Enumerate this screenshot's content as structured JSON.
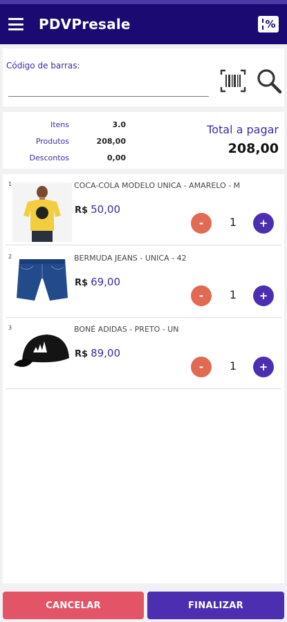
{
  "app": {
    "title": "PDVPresale"
  },
  "barcode": {
    "label": "Código de barras:",
    "value": "",
    "placeholder": ""
  },
  "summary": {
    "items_label": "Itens",
    "items_value": "3.0",
    "products_label": "Produtos",
    "products_value": "208,00",
    "discounts_label": "Descontos",
    "discounts_value": "0,00",
    "total_label": "Total a pagar",
    "total_value": "208,00"
  },
  "items": [
    {
      "index": "1",
      "name": "COCA-COLA MODELO UNICA - AMARELO - M",
      "currency": "R$",
      "price": "50,00",
      "qty": "1",
      "image": "yellow-tshirt"
    },
    {
      "index": "2",
      "name": "BERMUDA JEANS - UNICA - 42",
      "currency": "R$",
      "price": "69,00",
      "qty": "1",
      "image": "denim-shorts"
    },
    {
      "index": "3",
      "name": "BONÉ ADIDAS - PRETO - UN",
      "currency": "R$",
      "price": "89,00",
      "qty": "1",
      "image": "black-cap"
    }
  ],
  "buttons": {
    "minus": "-",
    "plus": "+",
    "cancel": "CANCELAR",
    "finish": "FINALIZAR"
  },
  "colors": {
    "appbar": "#1a0a72",
    "accent": "#4b2fb0",
    "minus": "#e06a52",
    "cancel": "#e35566"
  },
  "icons": {
    "menu": "menu-icon",
    "discount": "discount-icon",
    "barcode": "barcode-icon",
    "search": "search-icon"
  }
}
